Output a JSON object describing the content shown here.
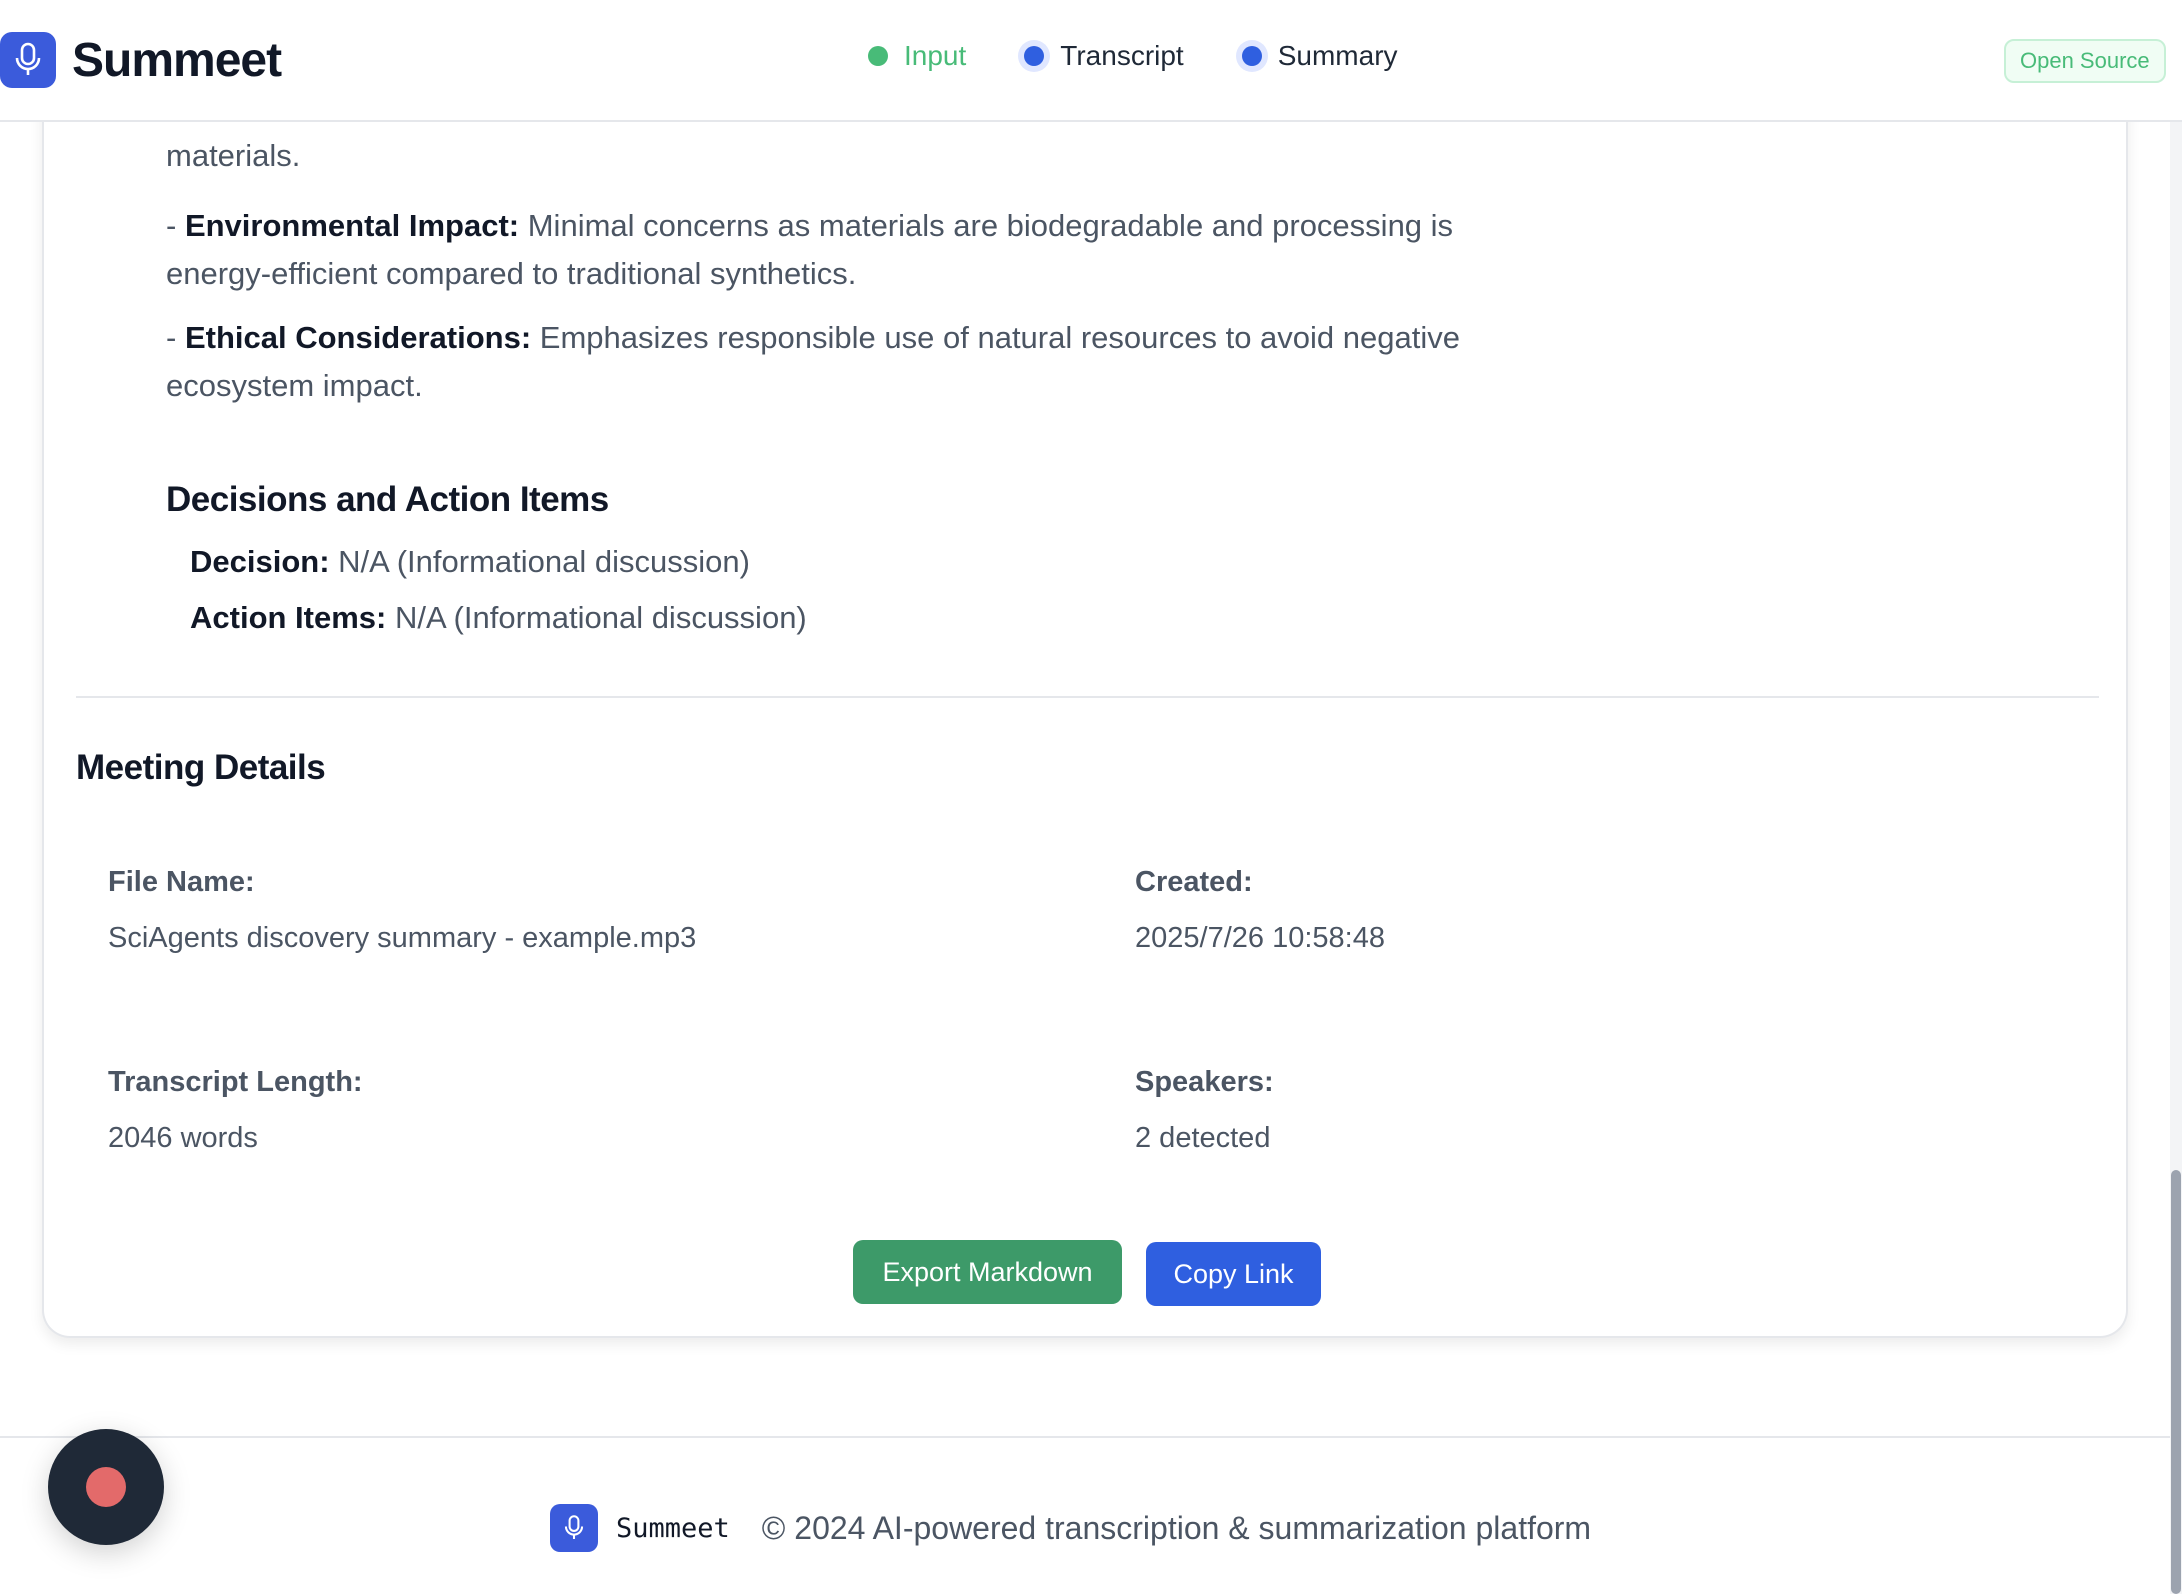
{
  "header": {
    "brand": "Summeet",
    "steps": [
      {
        "label": "Input",
        "state": "complete"
      },
      {
        "label": "Transcript",
        "state": "active"
      },
      {
        "label": "Summary",
        "state": "active"
      }
    ],
    "badge": "Open Source"
  },
  "summary": {
    "partial_line": "materials.",
    "items": [
      {
        "prefix": "- ",
        "label": "Environmental Impact:",
        "text": " Minimal concerns as materials are biodegradable and processing is energy-efficient compared to traditional synthetics."
      },
      {
        "prefix": "- ",
        "label": "Ethical Considerations:",
        "text": " Emphasizes responsible use of natural resources to avoid negative ecosystem impact."
      }
    ],
    "decisions_title": "Decisions and Action Items",
    "decision": {
      "label": "Decision:",
      "text": " N/A (Informational discussion)"
    },
    "action_items": {
      "label": "Action Items:",
      "text": " N/A (Informational discussion)"
    }
  },
  "meeting_details": {
    "title": "Meeting Details",
    "file_name": {
      "label": "File Name:",
      "value": "SciAgents discovery summary - example.mp3"
    },
    "created": {
      "label": "Created:",
      "value": "2025/7/26 10:58:48"
    },
    "transcript_length": {
      "label": "Transcript Length:",
      "value": "2046 words"
    },
    "speakers": {
      "label": "Speakers:",
      "value": "2 detected"
    }
  },
  "actions": {
    "export_label": "Export Markdown",
    "copy_label": "Copy Link"
  },
  "footer": {
    "brand": "Summeet",
    "copyright": "© 2024 AI-powered transcription & summarization platform"
  },
  "colors": {
    "primary": "#2f5fe0",
    "success": "#3d9a69",
    "step_complete": "#48bb78",
    "record": "#e36a6a"
  }
}
